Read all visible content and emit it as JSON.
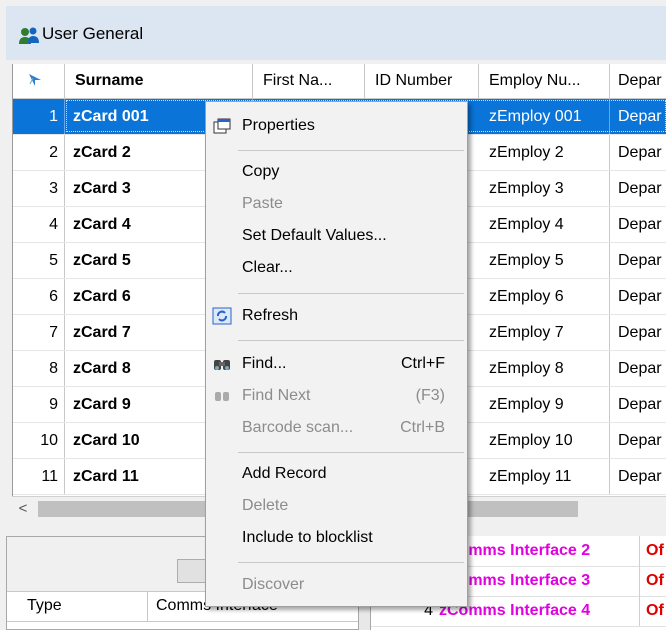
{
  "window": {
    "title": "User General",
    "title_icon": "users-icon"
  },
  "grid": {
    "columns": [
      {
        "label": "",
        "icon": "sort-arrow-icon"
      },
      {
        "label": "Surname"
      },
      {
        "label": "First Na..."
      },
      {
        "label": "ID Number"
      },
      {
        "label": "Employ Nu..."
      },
      {
        "label": "Depar"
      }
    ],
    "rows": [
      {
        "num": "1",
        "surname": "zCard 001",
        "employ": "zEmploy 001",
        "dept": "Depar"
      },
      {
        "num": "2",
        "surname": "zCard 2",
        "employ": "zEmploy 2",
        "dept": "Depar"
      },
      {
        "num": "3",
        "surname": "zCard 3",
        "employ": "zEmploy 3",
        "dept": "Depar"
      },
      {
        "num": "4",
        "surname": "zCard 4",
        "employ": "zEmploy 4",
        "dept": "Depar"
      },
      {
        "num": "5",
        "surname": "zCard 5",
        "employ": "zEmploy 5",
        "dept": "Depar"
      },
      {
        "num": "6",
        "surname": "zCard 6",
        "employ": "zEmploy 6",
        "dept": "Depar"
      },
      {
        "num": "7",
        "surname": "zCard 7",
        "employ": "zEmploy 7",
        "dept": "Depar"
      },
      {
        "num": "8",
        "surname": "zCard 8",
        "employ": "zEmploy 8",
        "dept": "Depar"
      },
      {
        "num": "9",
        "surname": "zCard 9",
        "employ": "zEmploy 9",
        "dept": "Depar"
      },
      {
        "num": "10",
        "surname": "zCard 10",
        "employ": "zEmploy 10",
        "dept": "Depar"
      },
      {
        "num": "11",
        "surname": "zCard 11",
        "employ": "zEmploy 11",
        "dept": "Depar"
      }
    ],
    "selected_row": "1"
  },
  "scrollbar": {
    "left_arrow": "<"
  },
  "lower_left": {
    "type_header": "Type",
    "comms_header": "Comms Interface"
  },
  "lower_right": {
    "rows": [
      {
        "num": "",
        "comms": "zComms Interface 2",
        "status": "Of"
      },
      {
        "num": "",
        "comms": "zComms Interface 3",
        "status": "Of"
      },
      {
        "num": "4",
        "comms": "zComms Interface 4",
        "status": "Of"
      }
    ]
  },
  "context_menu": {
    "properties": "Properties",
    "copy": "Copy",
    "paste": "Paste",
    "set_default": "Set Default Values...",
    "clear": "Clear...",
    "refresh": "Refresh",
    "find": "Find...",
    "find_shortcut": "Ctrl+F",
    "find_next": "Find Next",
    "find_next_shortcut": "(F3)",
    "barcode": "Barcode scan...",
    "barcode_shortcut": "Ctrl+B",
    "add_record": "Add Record",
    "delete": "Delete",
    "blocklist": "Include to blocklist",
    "discover": "Discover"
  },
  "colors": {
    "selection": "#0a74d8",
    "magenta": "#e000e0",
    "red": "#e00000"
  }
}
